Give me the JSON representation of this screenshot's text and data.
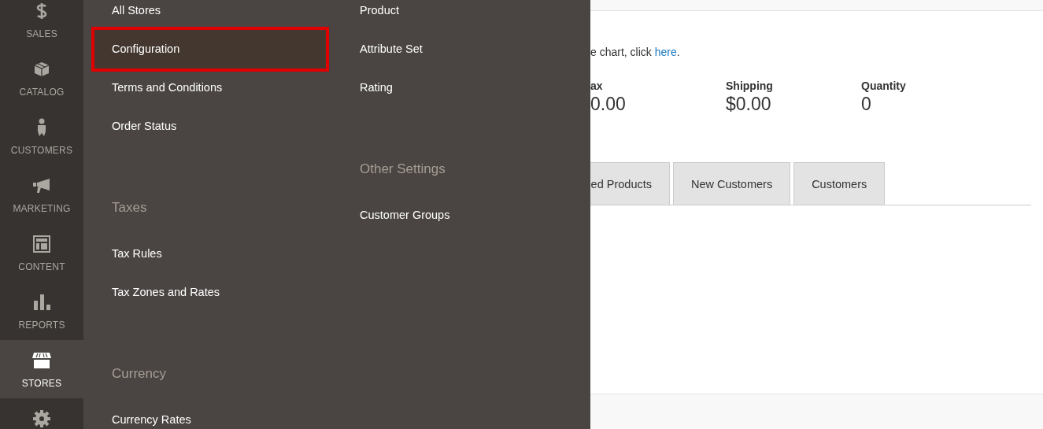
{
  "sidebar": {
    "items": [
      {
        "label": "SALES",
        "selected": false
      },
      {
        "label": "CATALOG",
        "selected": false
      },
      {
        "label": "CUSTOMERS",
        "selected": false
      },
      {
        "label": "MARKETING",
        "selected": false
      },
      {
        "label": "CONTENT",
        "selected": false
      },
      {
        "label": "REPORTS",
        "selected": false
      },
      {
        "label": "STORES",
        "selected": true
      }
    ]
  },
  "menu": {
    "columns": [
      {
        "sections": [
          {
            "items": [
              {
                "label": "All Stores",
                "selected": false
              },
              {
                "label": "Configuration",
                "selected": true
              },
              {
                "label": "Terms and Conditions",
                "selected": false
              },
              {
                "label": "Order Status",
                "selected": false
              }
            ]
          },
          {
            "heading": "Taxes",
            "items": [
              {
                "label": "Tax Rules",
                "selected": false
              },
              {
                "label": "Tax Zones and Rates",
                "selected": false
              }
            ]
          },
          {
            "heading": "Currency",
            "items": [
              {
                "label": "Currency Rates",
                "selected": false
              }
            ]
          }
        ]
      },
      {
        "sections": [
          {
            "items": [
              {
                "label": "Product",
                "selected": false
              },
              {
                "label": "Attribute Set",
                "selected": false
              },
              {
                "label": "Rating",
                "selected": false
              }
            ]
          },
          {
            "heading": "Other Settings",
            "items": [
              {
                "label": "Customer Groups",
                "selected": false
              }
            ]
          }
        ]
      }
    ]
  },
  "main": {
    "hint": {
      "text": "e chart, click ",
      "link": "here",
      "after": "."
    },
    "stats": [
      {
        "label": "ax",
        "value": "0.00"
      },
      {
        "label": "Shipping",
        "value": "$0.00"
      },
      {
        "label": "Quantity",
        "value": "0"
      }
    ],
    "tabs": [
      {
        "label": "ed Products",
        "selected": false
      },
      {
        "label": "New Customers",
        "selected": false
      },
      {
        "label": "Customers",
        "selected": false
      }
    ]
  }
}
